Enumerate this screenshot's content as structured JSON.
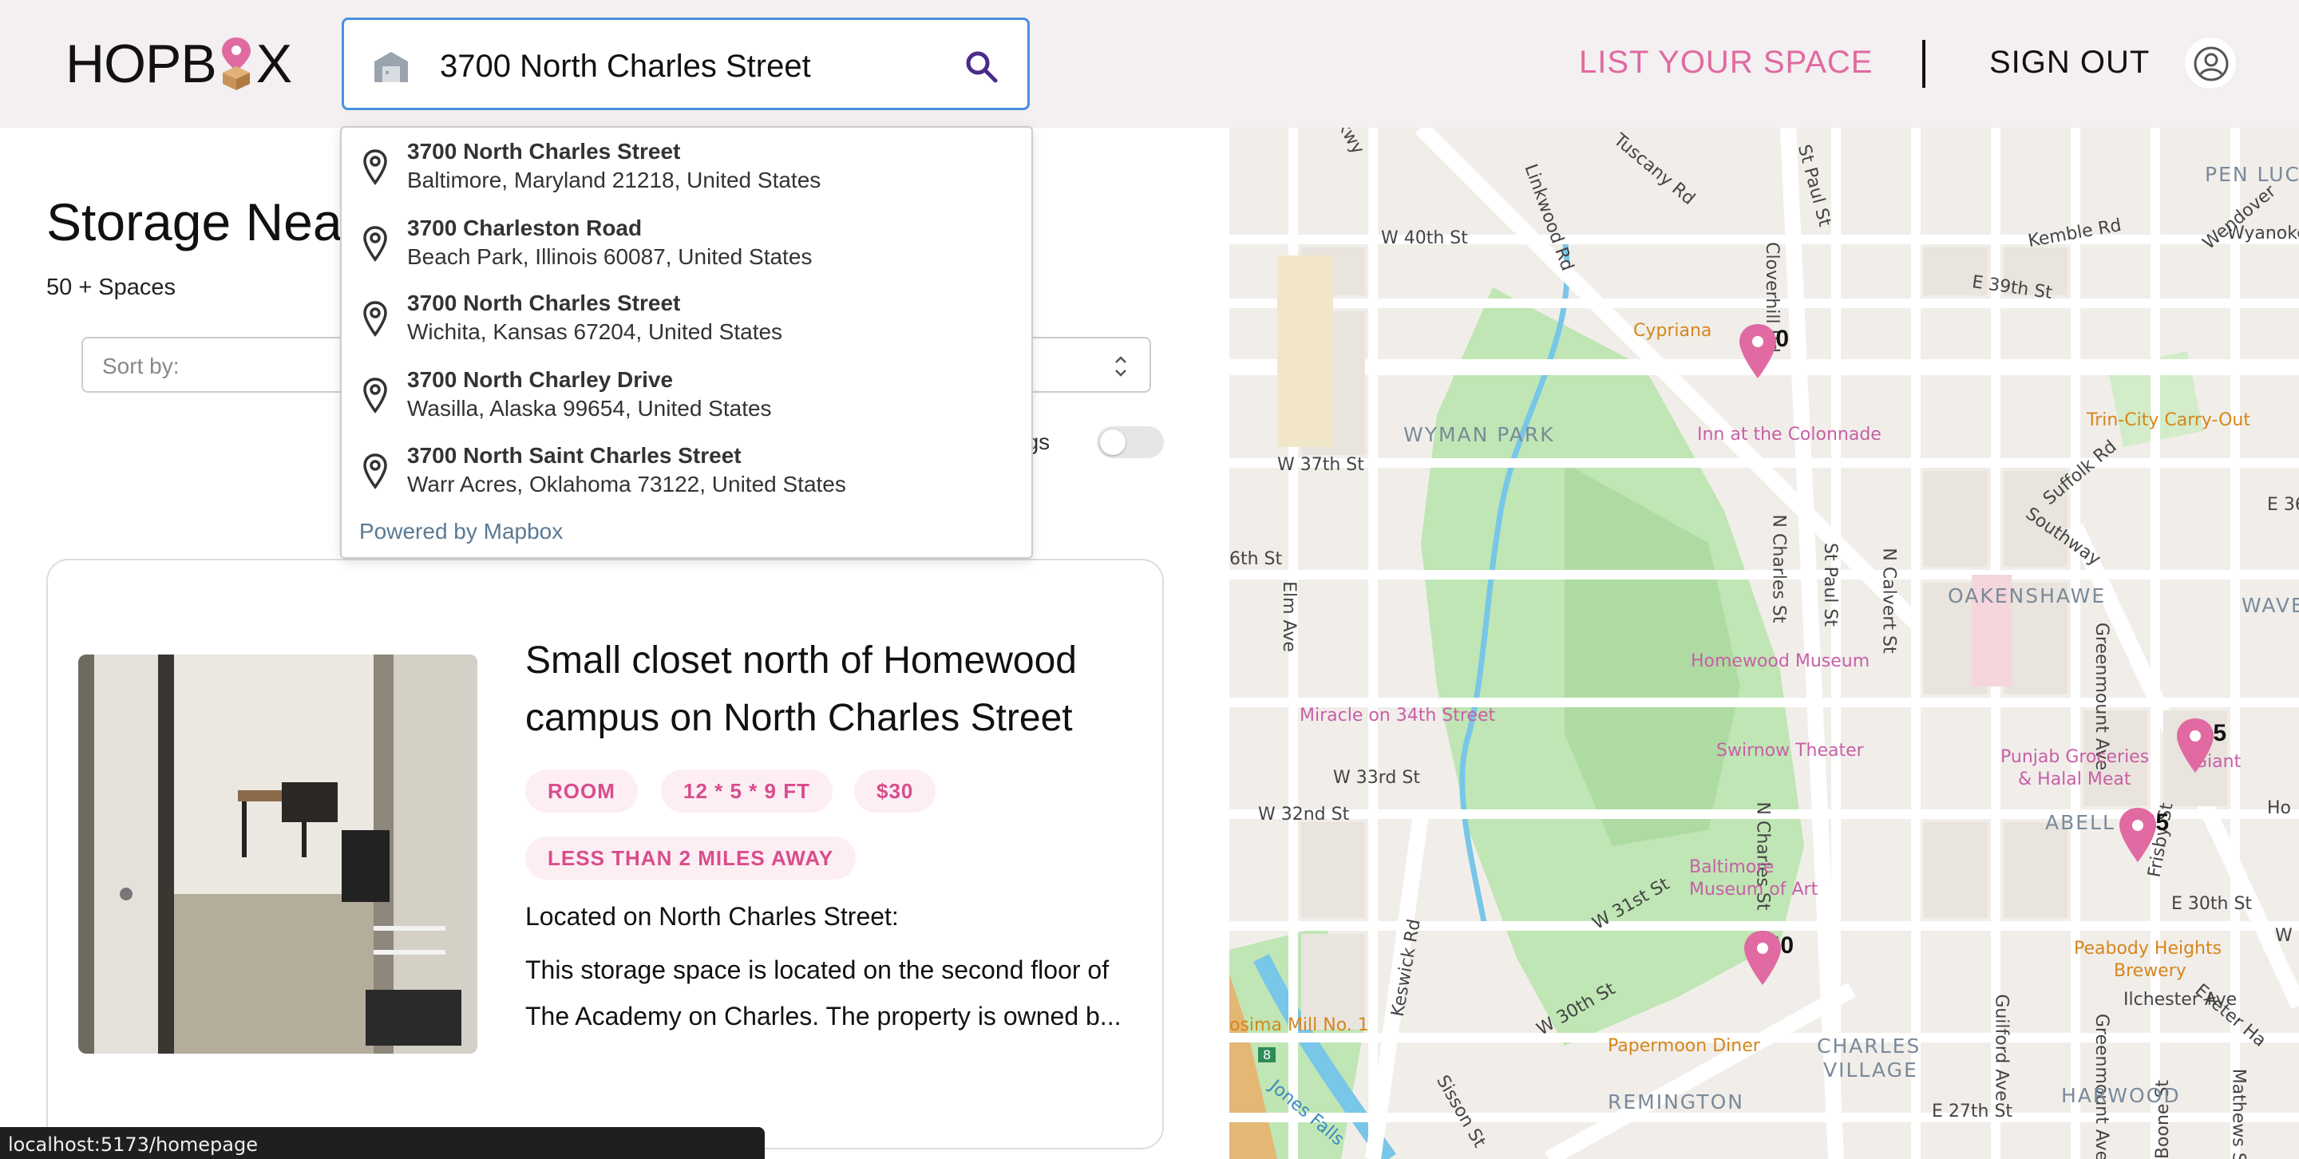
{
  "header": {
    "logo_text_left": "HOPB",
    "logo_text_right": "X",
    "search_value": "3700 North Charles Street",
    "list_space_label": "LIST YOUR SPACE",
    "sign_out_label": "SIGN OUT",
    "colors": {
      "accent": "#e06aa1",
      "search_border": "#4a90e2"
    }
  },
  "results": {
    "title": "Storage Near",
    "count": "50 + Spaces",
    "sort_label": "Sort by:",
    "toggle_label": "tings"
  },
  "dropdown": {
    "items": [
      {
        "main": "3700 North Charles Street",
        "sub": "Baltimore, Maryland 21218, United States"
      },
      {
        "main": "3700 Charleston Road",
        "sub": "Beach Park, Illinois 60087, United States"
      },
      {
        "main": "3700 North Charles Street",
        "sub": "Wichita, Kansas 67204, United States"
      },
      {
        "main": "3700 North Charley Drive",
        "sub": "Wasilla, Alaska 99654, United States"
      },
      {
        "main": "3700 North Saint Charles Street",
        "sub": "Warr Acres, Oklahoma 73122, United States"
      }
    ],
    "powered_by": "Powered by Mapbox"
  },
  "listing": {
    "title": "Small closet north of Homewood campus on North Charles Street",
    "tags": [
      "ROOM",
      "12 * 5 * 9 FT",
      "$30",
      "LESS THAN 2 MILES AWAY"
    ],
    "desc_head": "Located on North Charles Street:",
    "desc": "This storage space is located on the second floor of The Academy on Charles. The property is owned b..."
  },
  "map": {
    "pins": [
      "$30",
      "$15",
      "$65",
      "$40"
    ],
    "labels": {
      "w40": "W 40th St",
      "w37": "W 37th St",
      "w33": "W 33rd St",
      "w32": "W 32nd St",
      "w31": "W 31st St",
      "w30": "W 30th St",
      "e39": "E 39th St",
      "e30": "E 30th St",
      "e27": "E 27th St",
      "stpaul1": "St Paul St",
      "stpaul2": "St Paul St",
      "ncharles1": "N Charles St",
      "ncharles2": "N Charles St",
      "ncalvert": "N Calvert St",
      "greenmount": "Greenmount Ave",
      "greenmount2": "Greenmount Ave",
      "guilford": "Guilford Ave",
      "keswick": "Keswick Rd",
      "sisson": "Sisson St",
      "elm": "Elm Ave",
      "cloverhill": "Cloverhill Rd",
      "linkwood": "Linkwood Rd",
      "tuscany": "Tuscany Rd",
      "kemble": "Kemble Rd",
      "wendover": "Wendover",
      "wyanoke": "Wyanoke",
      "suffolk": "Suffolk Rd",
      "southway": "Southway",
      "ilchester": "Ilchester Ave",
      "exeter": "Exeter Ha",
      "frisby": "Frisby St",
      "boone": "Boone St",
      "mathews": "Mathews St",
      "st36": "6th St",
      "pkwy": "kwy",
      "wyman": "WYMAN PARK",
      "oakenshawe": "OAKENSHAWE",
      "abell": "ABELL",
      "charles_village1": "CHARLES",
      "charles_village2": "VILLAGE",
      "remington": "REMINGTON",
      "harwood": "HARWOOD",
      "penlucy": "PEN LUCY",
      "waver": "WAVER",
      "cypriana": "Cypriana",
      "inn": "Inn at the Colonnade",
      "homewood": "Homewood Museum",
      "miracle": "Miracle on 34th Street",
      "swirnow": "Swirnow Theater",
      "bma1": "Baltimore",
      "bma2": "Museum of Art",
      "trincity": "Trin-City Carry-Out",
      "punjab1": "Punjab Groceries",
      "punjab2": "& Halal Meat",
      "giant": "Giant",
      "peabody1": "Peabody Heights",
      "peabody2": "Brewery",
      "papermoon": "Papermoon Diner",
      "cosima": "osima Mill No. 1",
      "jones": "Jones Falls",
      "route": "8",
      "e30e": "E 30th St",
      "e36": "E 36",
      "ho": "Ho",
      "w": "W"
    },
    "colors": {
      "park": "#bfe6b4",
      "water": "#78c6e8",
      "road": "#ffffff",
      "land": "#f1eeea",
      "pin": "#e06aa1"
    }
  },
  "statusbar": {
    "url": "localhost:5173/homepage"
  }
}
